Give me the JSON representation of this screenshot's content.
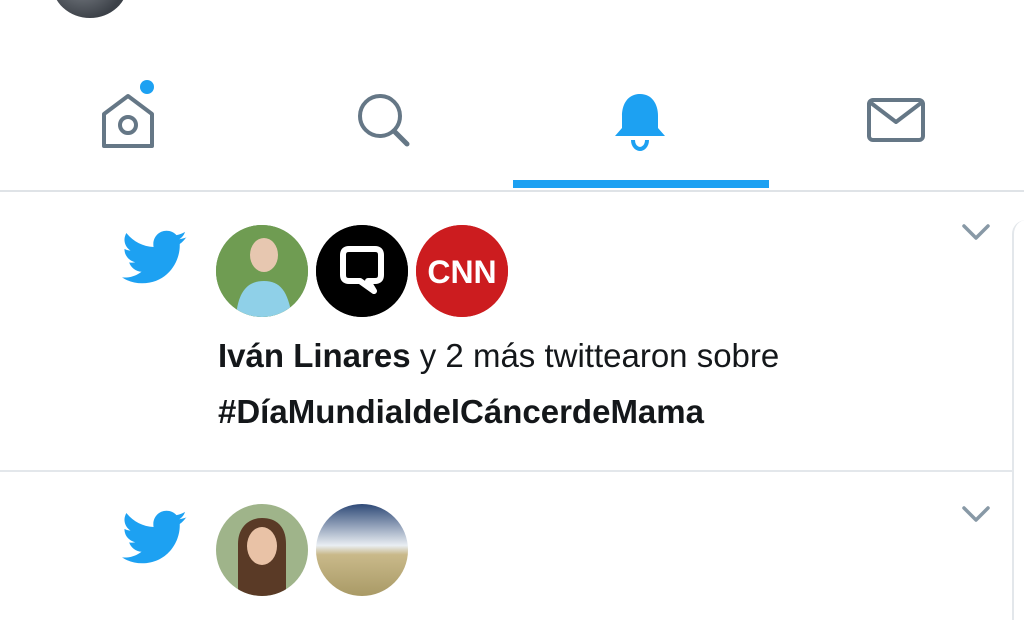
{
  "colors": {
    "accent": "#1da1f2",
    "icon_inactive": "#657786",
    "divider": "#e3e7eb",
    "cnn_red": "#cc1c1f"
  },
  "nav": {
    "tabs": [
      {
        "name": "home",
        "icon": "home-icon",
        "active": false,
        "has_dot": true
      },
      {
        "name": "search",
        "icon": "search-icon",
        "active": false
      },
      {
        "name": "notifications",
        "icon": "bell-icon",
        "active": true
      },
      {
        "name": "messages",
        "icon": "envelope-icon",
        "active": false
      }
    ]
  },
  "notifications": [
    {
      "icon": "twitter-bird-icon",
      "avatars": [
        "avatar-ivan-linares",
        "avatar-quote-bubble",
        "avatar-cnn"
      ],
      "cnn_logo_text": "CNN",
      "actor": "Iván Linares",
      "text": " y 2 más twittearon sobre",
      "hashtag": "#DíaMundialdelCáncerdeMama"
    },
    {
      "icon": "twitter-bird-icon",
      "avatars": [
        "avatar-woman",
        "avatar-landscape"
      ]
    }
  ]
}
